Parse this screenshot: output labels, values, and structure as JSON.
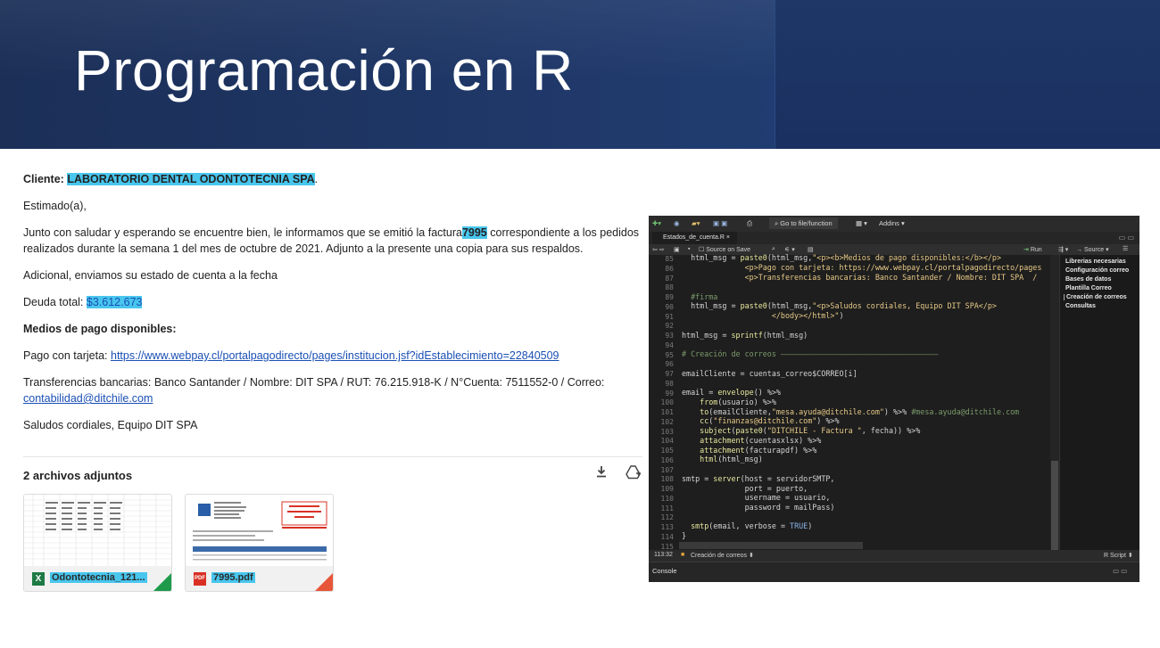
{
  "slide": {
    "title": "Programación en R"
  },
  "email": {
    "client_label": "Cliente:",
    "client_name": "LABORATORIO DENTAL ODONTOTECNIA SPA",
    "client_end": ".",
    "greeting": "Estimado(a),",
    "body1_pre": "Junto con saludar y esperando se encuentre bien, le informamos que se emitió la factura",
    "invoice_number": "7995",
    "body1_post": "correspondiente a los pedidos",
    "body2": "realizados durante la semana 1 del mes de octubre de 2021. Adjunto a la presente una copia para sus respaldos.",
    "additional": "Adicional, enviamos su estado de cuenta a la fecha",
    "debt_label": "Deuda total:",
    "debt_value": "$3.612.673",
    "payment_heading": "Medios de pago disponibles:",
    "card_label": "Pago con tarjeta:",
    "card_link": "https://www.webpay.cl/portalpagodirecto/pages/institucion.jsf?idEstablecimiento=22840509",
    "transfer_text": "Transferencias bancarias: Banco Santander / Nombre: DIT SPA / RUT: 76.215.918-K / N°Cuenta: 7511552-0 / Correo:",
    "transfer_email": "contabilidad@ditchile.com",
    "signature": "Saludos cordiales, Equipo DIT SPA"
  },
  "attachments": {
    "title": "2 archivos adjuntos",
    "download_icon": "download-icon",
    "drive_icon": "add-to-drive-icon",
    "files": [
      {
        "name": "Odontotecnia_121...",
        "type": "xlsx",
        "icon_text": "X",
        "color": "#1d7a44"
      },
      {
        "name": "7995.pdf",
        "type": "pdf",
        "icon_text": "PDF",
        "color": "#d93025"
      }
    ]
  },
  "rstudio": {
    "toolbar": {
      "goto": "Go to file/function",
      "addins": "Addins"
    },
    "tab": "Estados_de_cuenta.R",
    "editor_toolbar": {
      "source_on_save": "Source on Save",
      "run": "Run",
      "source": "Source"
    },
    "outline": [
      "Librerias necesarias",
      "Configuración correo",
      "Bases de datos",
      "Plantilla Correo",
      "Creación de correos",
      "Consultas"
    ],
    "line_numbers": [
      "85",
      "86",
      "87",
      "88",
      "89",
      "90",
      "91",
      "92",
      "93",
      "94",
      "95",
      "96",
      "97",
      "98",
      "99",
      "100",
      "101",
      "102",
      "103",
      "104",
      "105",
      "106",
      "107",
      "108",
      "109",
      "110",
      "111",
      "112",
      "113",
      "114",
      "115"
    ],
    "status": {
      "position": "113:32",
      "section": "Creación de correos",
      "filetype": "R Script"
    },
    "console": "Console"
  }
}
